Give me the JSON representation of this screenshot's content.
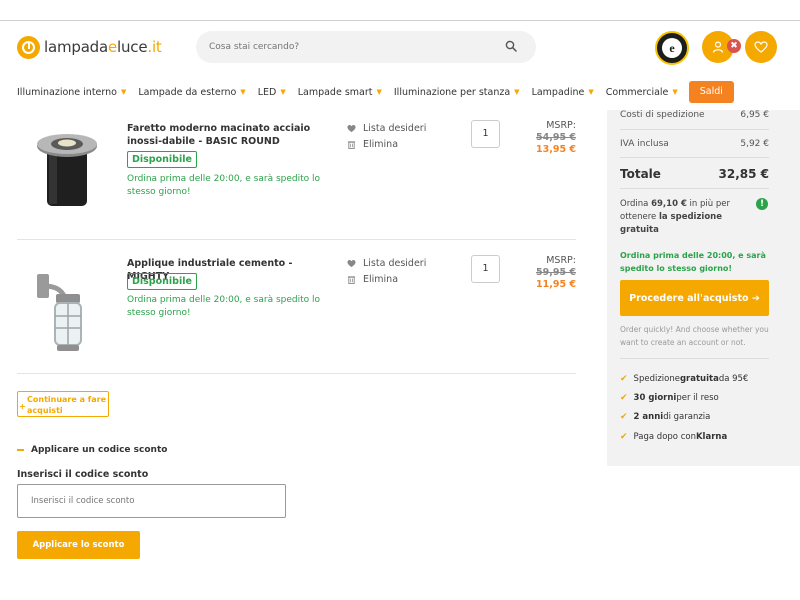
{
  "header": {
    "logo_main": "lampada",
    "logo_accent": "e",
    "logo_end": "luce",
    "logo_tld": ".it",
    "search_placeholder": "Cosa stai cercando?",
    "trust_letter": "e",
    "close_badge": "✖"
  },
  "nav": {
    "items": [
      {
        "label": "Illuminazione interno"
      },
      {
        "label": "Lampade da esterno"
      },
      {
        "label": "LED"
      },
      {
        "label": "Lampade smart"
      },
      {
        "label": "Illuminazione per stanza"
      },
      {
        "label": "Lampadine"
      },
      {
        "label": "Commerciale"
      }
    ],
    "sale_label": "Saldi",
    "caret": "▼"
  },
  "cart": {
    "items": [
      {
        "name": "Faretto moderno macinato acciaio inossi-dabile - BASIC ROUND",
        "availability": "Disponibile",
        "ship_note": "Ordina prima delle 20:00, e sarà spedito lo stesso giorno!",
        "wishlist_label": "Lista desideri",
        "delete_label": "Elimina",
        "quantity": "1",
        "msrp_label": "MSRP:",
        "msrp": "54,95 €",
        "price": "13,95 €"
      },
      {
        "name": "Applique industriale cemento - MIGHTY",
        "availability": "Disponibile",
        "ship_note": "Ordina prima delle 20:00, e sarà spedito lo stesso giorno!",
        "wishlist_label": "Lista desideri",
        "delete_label": "Elimina",
        "quantity": "1",
        "msrp_label": "MSRP:",
        "msrp": "59,95 €",
        "price": "11,95 €"
      }
    ],
    "continue_label": "Continuare a fare acquisti",
    "continue_plus": "+"
  },
  "coupon": {
    "toggle_label": "Applicare un codice sconto",
    "field_label": "Inserisci il codice sconto",
    "placeholder": "Inserisci il codice sconto",
    "button_label": "Applicare lo sconto"
  },
  "summary": {
    "shipping_label": "Costi di spedizione",
    "shipping_value": "6,95 €",
    "vat_label": "IVA inclusa",
    "vat_value": "5,92 €",
    "total_label": "Totale",
    "total_value": "32,85 €",
    "free_ship_pre": "Ordina ",
    "free_ship_amount": "69,10 €",
    "free_ship_mid": " in più per ottenere ",
    "free_ship_bold": "la spedizione gratuita",
    "info_icon": "!",
    "ship_note": "Ordina prima delle 20:00, e sarà spedito lo stesso giorno!",
    "checkout_label": "Procedere all'acquisto ➔",
    "checkout_note": "Order quickly! And choose whether you want to create an account or not.",
    "check": "✔",
    "benefits": [
      {
        "pre": "Spedizione ",
        "bold": "gratuita",
        "post": " da 95€"
      },
      {
        "pre": "",
        "bold": "30 giorni",
        "post": " per il reso"
      },
      {
        "pre": "",
        "bold": "2 anni",
        "post": " di garanzia"
      },
      {
        "pre": "Paga dopo con ",
        "bold": "Klarna",
        "post": ""
      }
    ]
  },
  "colors": {
    "accent": "#f5a800",
    "sale": "#f58220",
    "available": "#2ca24a"
  }
}
